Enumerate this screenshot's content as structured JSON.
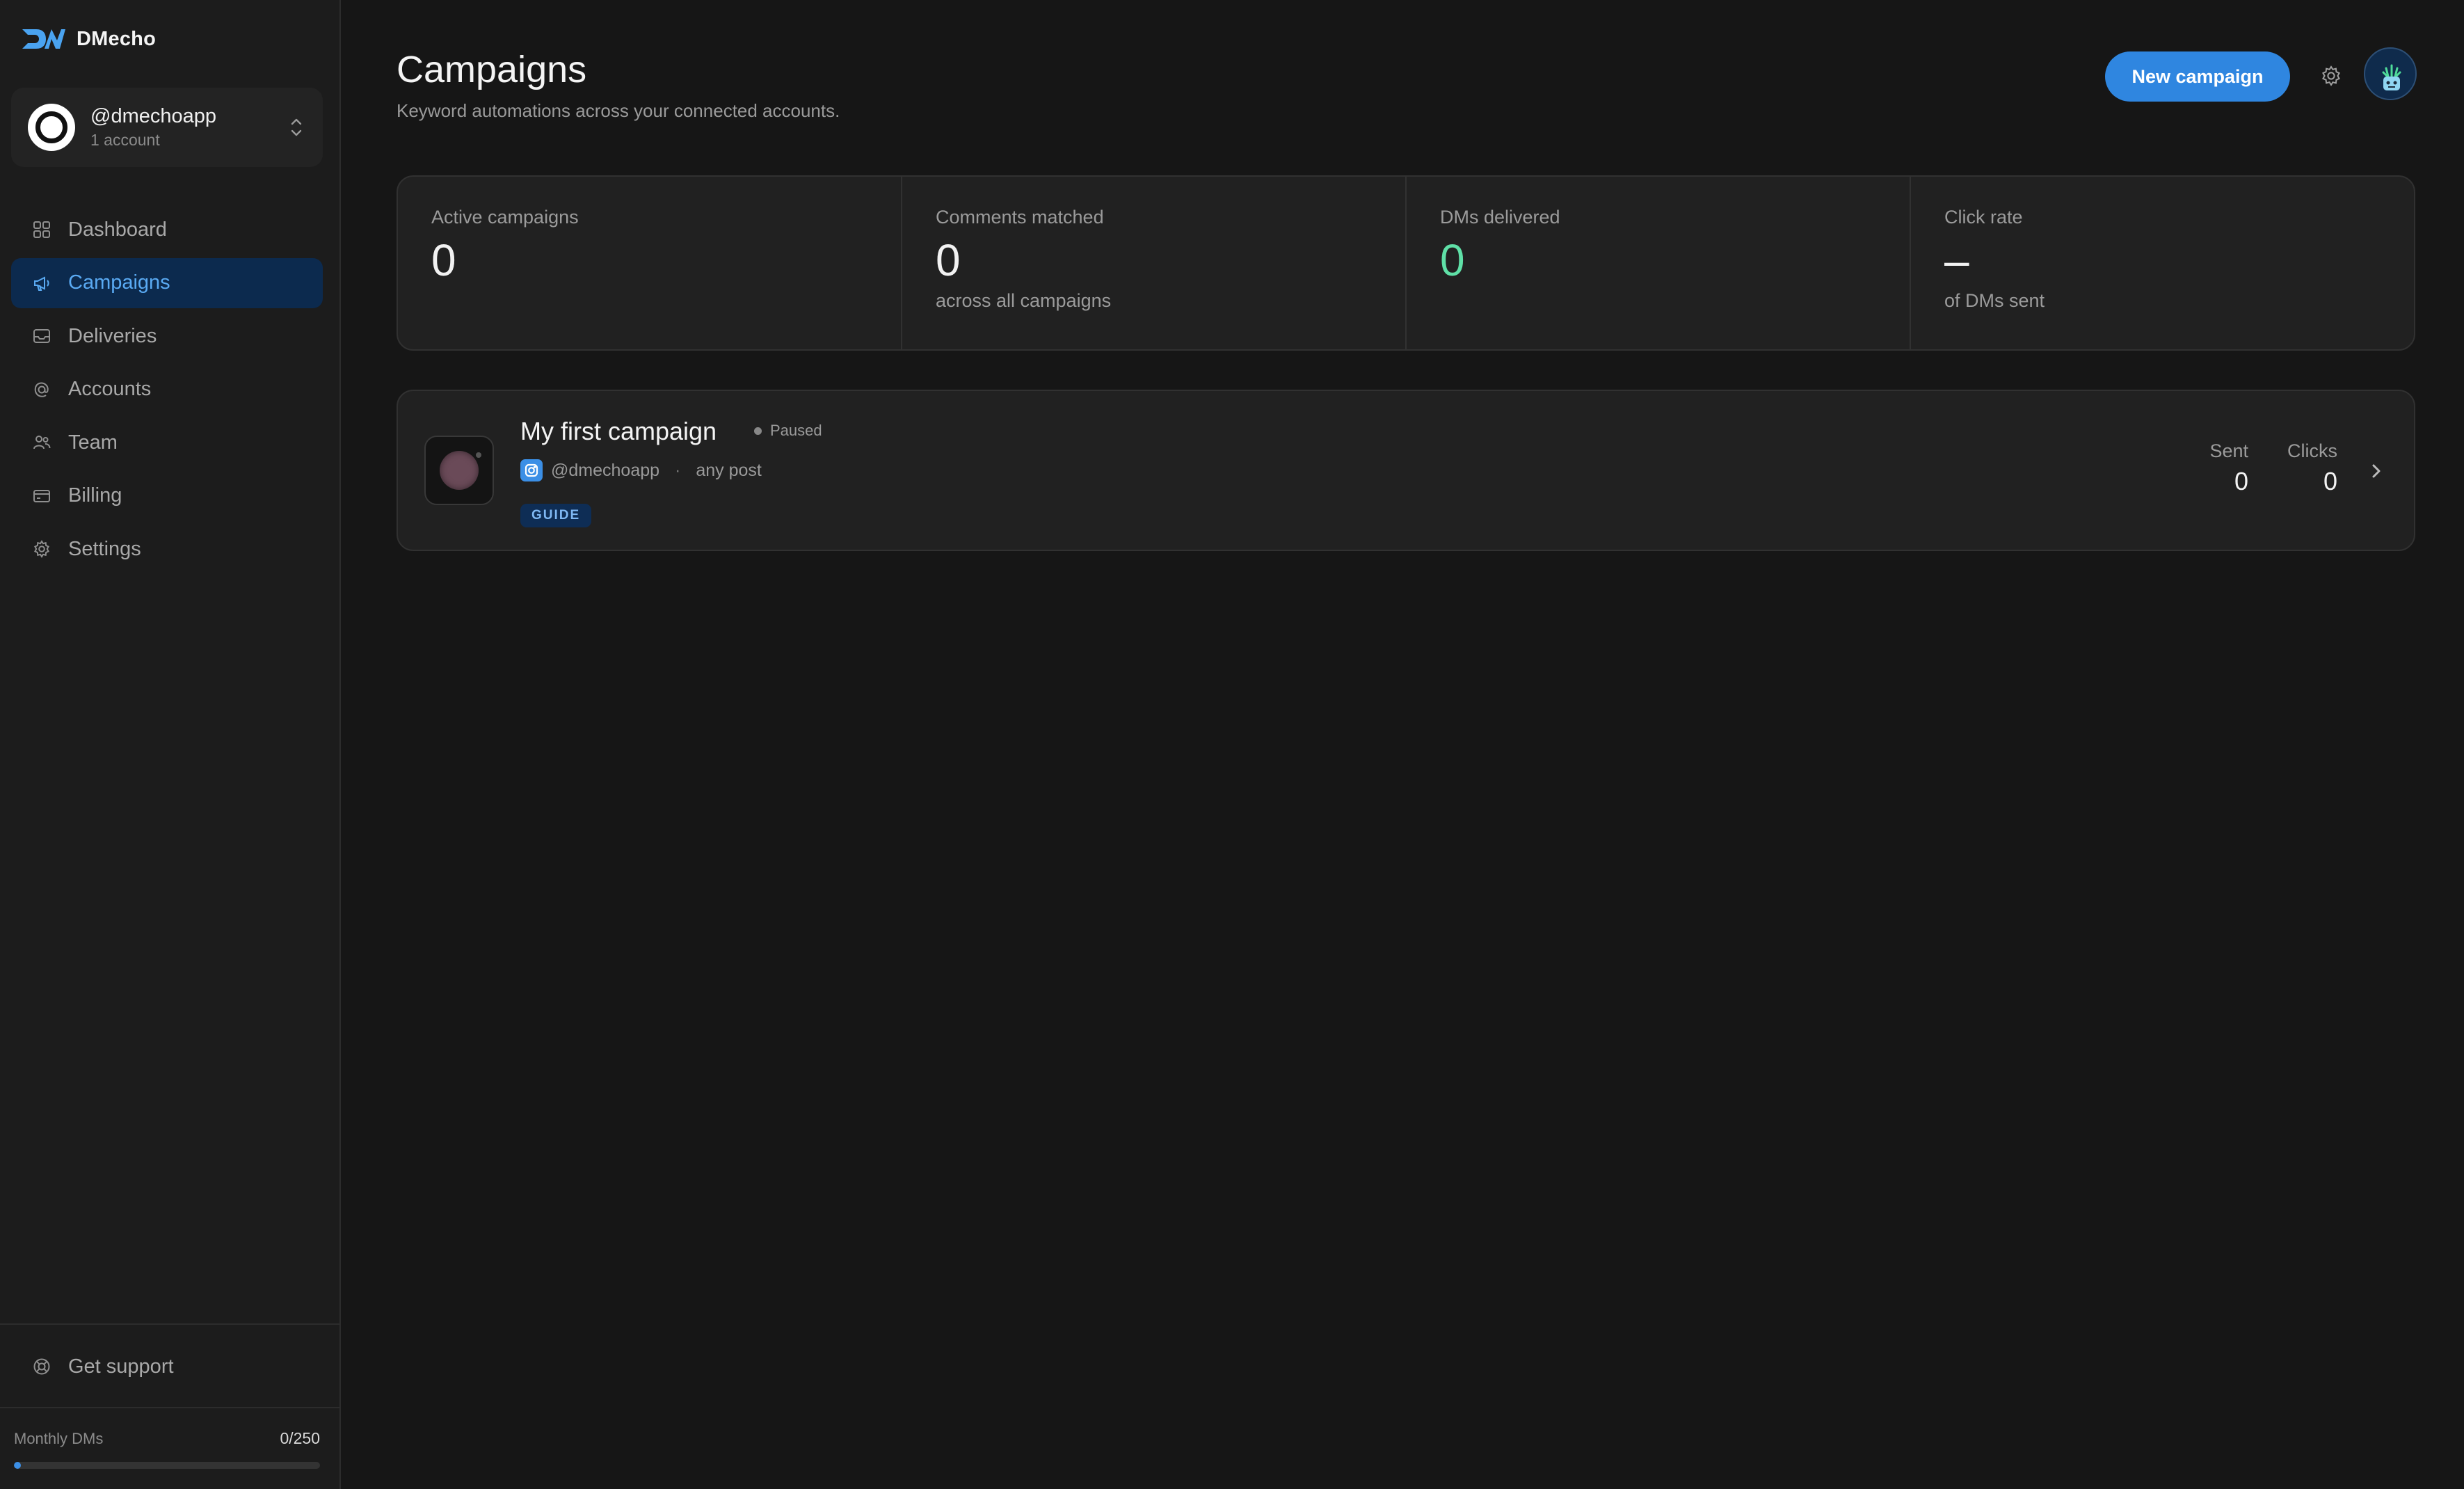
{
  "brand": {
    "name": "DMecho",
    "accent": "#4aa3f0"
  },
  "account_switcher": {
    "handle": "@dmechoapp",
    "count": "1 account"
  },
  "nav": {
    "items": [
      {
        "label": "Dashboard",
        "icon": "grid-icon"
      },
      {
        "label": "Campaigns",
        "icon": "megaphone-icon",
        "active": true
      },
      {
        "label": "Deliveries",
        "icon": "inbox-icon"
      },
      {
        "label": "Accounts",
        "icon": "at-icon"
      },
      {
        "label": "Team",
        "icon": "users-icon"
      },
      {
        "label": "Billing",
        "icon": "credit-card-icon"
      },
      {
        "label": "Settings",
        "icon": "gear-icon"
      }
    ],
    "active_color": "#5aaaf3",
    "active_bg": "#0c2a4e"
  },
  "support": {
    "label": "Get support",
    "icon": "lifebuoy-icon"
  },
  "usage": {
    "label": "Monthly DMs",
    "value": "0/250",
    "fraction": 0.0
  },
  "header": {
    "title": "Campaigns",
    "subtitle": "Keyword automations across your connected accounts.",
    "new_button": "New campaign"
  },
  "stats": [
    {
      "label": "Active campaigns",
      "value": "0",
      "sub": ""
    },
    {
      "label": "Comments matched",
      "value": "0",
      "sub": "across all campaigns"
    },
    {
      "label": "DMs delivered",
      "value": "0",
      "sub": "",
      "color": "#5fe0a7"
    },
    {
      "label": "Click rate",
      "value": "–",
      "sub": "of DMs sent"
    }
  ],
  "campaigns": [
    {
      "title": "My first campaign",
      "status": "Paused",
      "account": "@dmechoapp",
      "scope": "any post",
      "tag": "GUIDE",
      "sent_label": "Sent",
      "sent": "0",
      "clicks_label": "Clicks",
      "clicks": "0"
    }
  ]
}
